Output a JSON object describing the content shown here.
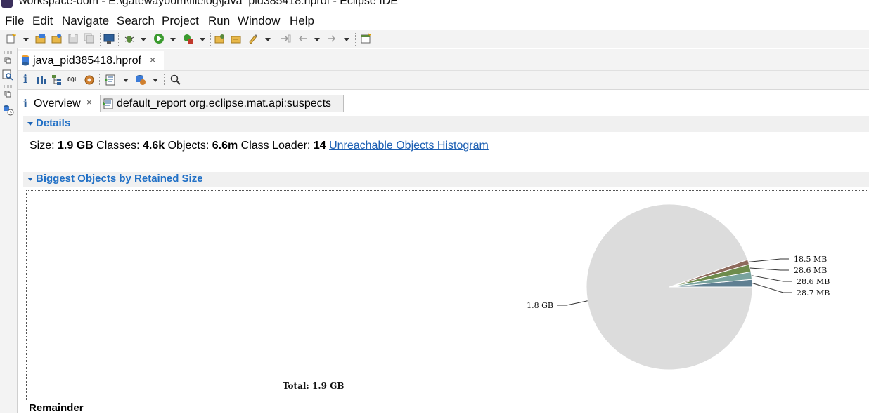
{
  "window": {
    "title": "workspace-oom - E:\\gatewayoom\\filelog\\java_pid385418.hprof - Eclipse IDE"
  },
  "menu": {
    "items": [
      "File",
      "Edit",
      "Navigate",
      "Search",
      "Project",
      "Run",
      "Window",
      "Help"
    ]
  },
  "editor": {
    "tab_label": "java_pid385418.hprof",
    "tab_close": "×"
  },
  "page_tabs": {
    "overview": "Overview",
    "report": "default_report  org.eclipse.mat.api:suspects",
    "overview_close": "×"
  },
  "details": {
    "heading": "Details",
    "size_label": "Size:",
    "size_value": "1.9 GB",
    "classes_label": "Classes:",
    "classes_value": "4.6k",
    "objects_label": "Objects:",
    "objects_value": "6.6m",
    "loader_label": "Class Loader:",
    "loader_value": "14",
    "histogram_link": "Unreachable Objects Histogram"
  },
  "biggest": {
    "heading": "Biggest Objects by Retained Size"
  },
  "chart_data": {
    "type": "pie",
    "unit": "MB",
    "slices": [
      {
        "label": "28.7 MB",
        "value": 28.7,
        "color": "#5f7f92"
      },
      {
        "label": "28.6 MB",
        "value": 28.6,
        "color": "#79a39e"
      },
      {
        "label": "28.6 MB",
        "value": 28.6,
        "color": "#6e8c4c"
      },
      {
        "label": "18.5 MB",
        "value": 18.5,
        "color": "#8e6a5c"
      },
      {
        "label": "1.8 GB",
        "value": 1843.2,
        "color": "#dcdcdc"
      }
    ],
    "total_label": "Total: 1.9 GB"
  },
  "remainder": {
    "label": "Remainder"
  },
  "colors": {
    "accent": "#2170c6",
    "link": "#1c5fb3",
    "panel": "#f3f3f3"
  }
}
